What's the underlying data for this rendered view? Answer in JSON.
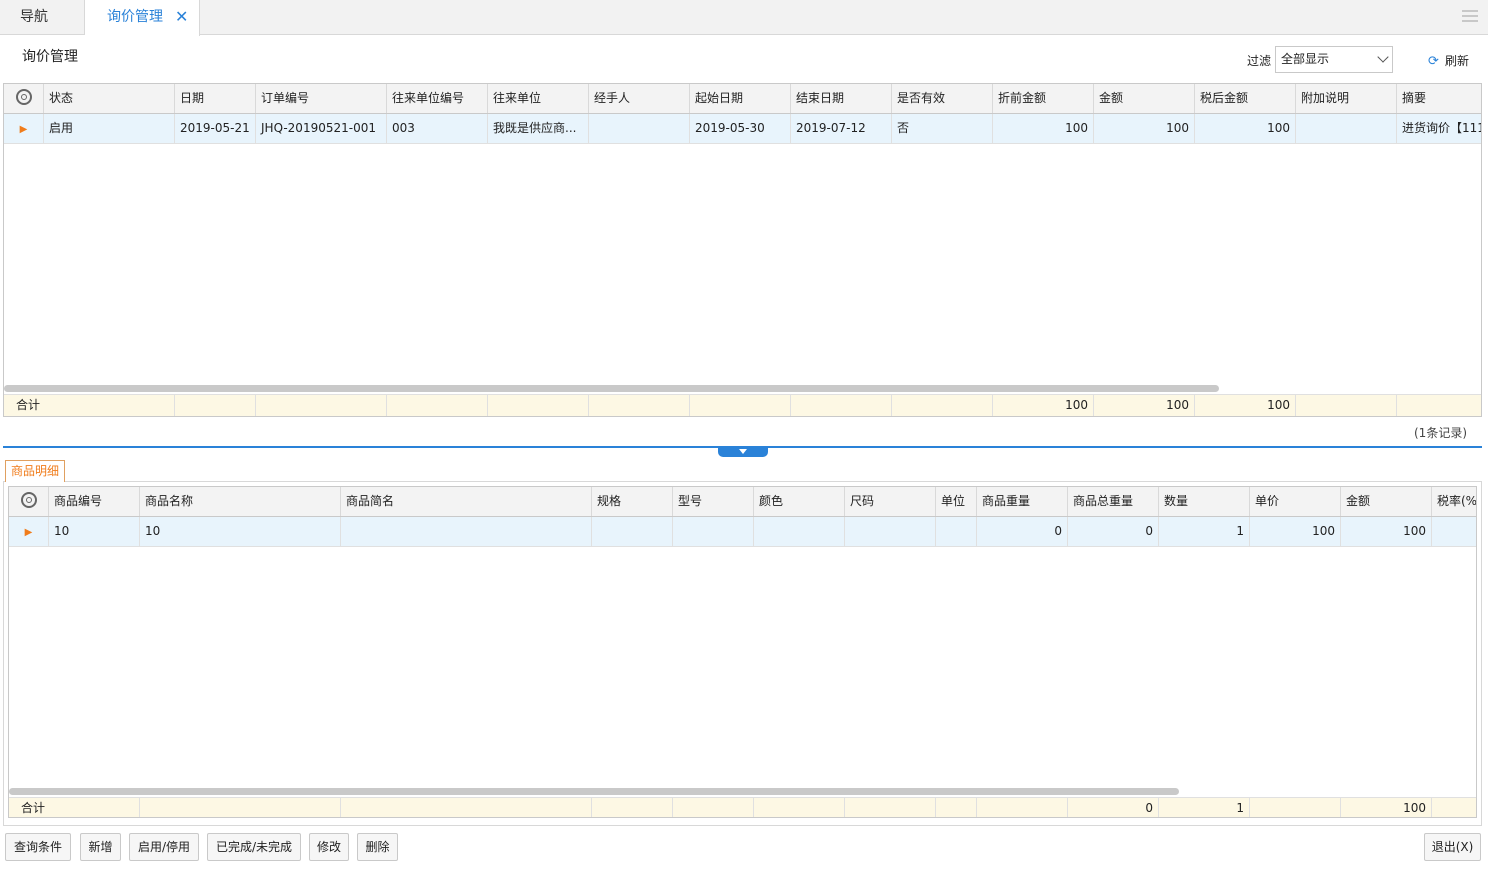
{
  "tabs": [
    {
      "label": "导航"
    },
    {
      "label": "询价管理",
      "close": "✕"
    }
  ],
  "page_title": "询价管理",
  "filter": {
    "label": "过滤",
    "value": "全部显示"
  },
  "refresh_label": "刷新",
  "main_grid": {
    "columns": [
      "状态",
      "日期",
      "订单编号",
      "往来单位编号",
      "往来单位",
      "经手人",
      "起始日期",
      "结束日期",
      "是否有效",
      "折前金额",
      "金额",
      "税后金额",
      "附加说明",
      "摘要"
    ],
    "rows": [
      [
        "启用",
        "2019-05-21",
        "JHQ-20190521-001",
        "003",
        "我既是供应商...",
        "",
        "2019-05-30",
        "2019-07-12",
        "否",
        "100",
        "100",
        "100",
        "",
        "进货询价【111"
      ]
    ],
    "summary": {
      "label": "合计",
      "values": [
        "",
        "",
        "",
        "",
        "",
        "",
        "",
        "",
        "100",
        "100",
        "100",
        "",
        ""
      ]
    },
    "record_count": "(1条记录)"
  },
  "detail_tab": "商品明细",
  "detail_grid": {
    "columns": [
      "商品编号",
      "商品名称",
      "商品简名",
      "规格",
      "型号",
      "颜色",
      "尺码",
      "单位",
      "商品重量",
      "商品总重量",
      "数量",
      "单价",
      "金额",
      "税率(%"
    ],
    "rows": [
      [
        "10",
        "10",
        "",
        "",
        "",
        "",
        "",
        "",
        "0",
        "0",
        "1",
        "100",
        "100",
        ""
      ]
    ],
    "summary": {
      "label": "合计",
      "values": [
        "",
        "",
        "",
        "",
        "",
        "",
        "",
        "",
        "0",
        "1",
        "",
        "100",
        ""
      ]
    }
  },
  "buttons": {
    "query": "查询条件",
    "add": "新增",
    "toggle": "启用/停用",
    "complete": "已完成/未完成",
    "edit": "修改",
    "delete": "删除",
    "exit": "退出(X)"
  }
}
